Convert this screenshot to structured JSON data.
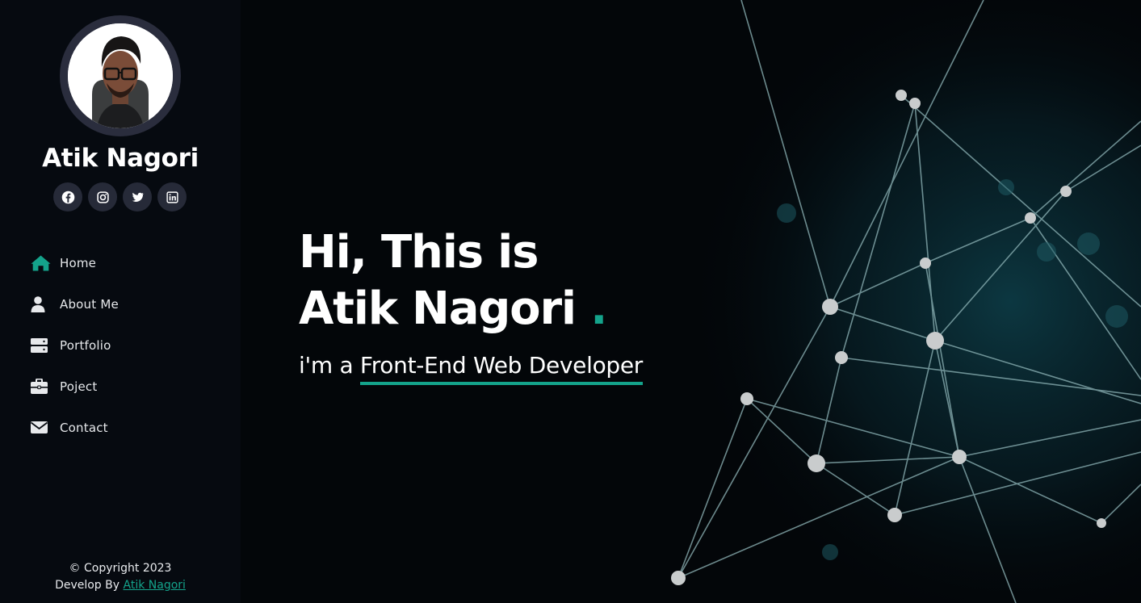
{
  "profile": {
    "name": "Atik Nagori",
    "avatar_alt": "profile photo"
  },
  "socials": [
    {
      "icon": "facebook-icon"
    },
    {
      "icon": "instagram-icon"
    },
    {
      "icon": "twitter-icon"
    },
    {
      "icon": "linkedin-icon"
    }
  ],
  "nav": {
    "items": [
      {
        "label": "Home",
        "icon": "home-icon",
        "active": true
      },
      {
        "label": "About Me",
        "icon": "user-icon"
      },
      {
        "label": "Portfolio",
        "icon": "server-icon"
      },
      {
        "label": "Poject",
        "icon": "briefcase-icon"
      },
      {
        "label": "Contact",
        "icon": "envelope-icon"
      }
    ]
  },
  "footer": {
    "copyright": "© Copyright 2023",
    "develop_by": "Develop By",
    "author_link": "Atik Nagori"
  },
  "hero": {
    "line1": "Hi, This is",
    "line2": "Atik Nagori",
    "dot": ".",
    "sub_prefix": "i'm a",
    "role": "Front-End Web Developer"
  },
  "colors": {
    "accent": "#14a38b",
    "sidebar_bg": "#060a10",
    "main_bg": "#030609"
  }
}
